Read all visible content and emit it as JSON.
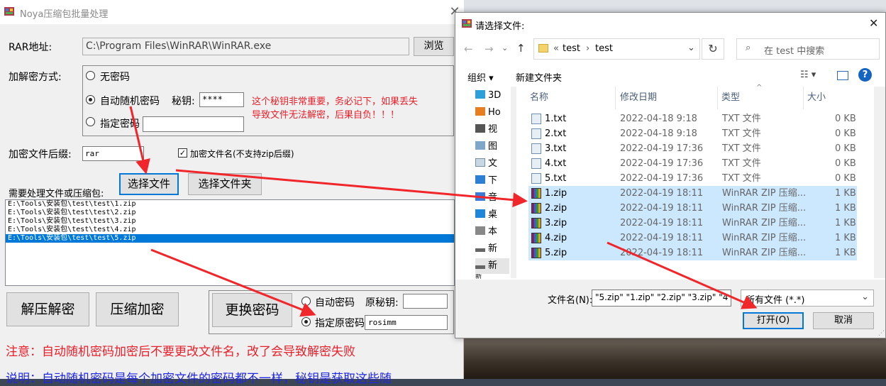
{
  "main": {
    "title": "Noya压缩包批量处理",
    "rar_label": "RAR地址:",
    "rar_path": "C:\\Program Files\\WinRAR\\WinRAR.exe",
    "browse": "浏览",
    "mode_label": "加解密方式:",
    "opt_none": "无密码",
    "opt_auto": "自动随机密码",
    "key_label": "秘钥:",
    "key_value": "****",
    "warning_line1": "这个秘钥非常重要，务必记下，如果丢失",
    "warning_line2": "导致文件无法解密，后果自负！！！",
    "opt_specify": "指定密码",
    "suffix_label": "加密文件后缀:",
    "suffix_value": "rar",
    "encrypt_name": "加密文件名(不支持zip后缀)",
    "select_file": "选择文件",
    "select_folder": "选择文件夹",
    "list_label": "需要处理文件或压缩包:",
    "files": [
      "E:\\Tools\\安装包\\test\\test\\1.zip",
      "E:\\Tools\\安装包\\test\\test\\2.zip",
      "E:\\Tools\\安装包\\test\\test\\3.zip",
      "E:\\Tools\\安装包\\test\\test\\4.zip",
      "E:\\Tools\\安装包\\test\\test\\5.zip"
    ],
    "decompress": "解压解密",
    "compress": "压缩加密",
    "change_pwd": "更换密码",
    "auto_pwd": "自动密码",
    "orig_key": "原秘钥:",
    "specify_orig": "指定原密码",
    "orig_pwd_value": "rosimm",
    "note": "注意：自动随机密码加密后不要更改文件名，改了会导致解密失败",
    "desc": "说明：自动随机密码是每个加密文件的密码都不一样，秘钥是获取这些随"
  },
  "dialog": {
    "title": "请选择文件:",
    "crumb_prefix": "«",
    "crumb1": "test",
    "crumb2": "test",
    "search_placeholder": "在 test 中搜索",
    "organize": "组织",
    "new_folder": "新建文件夹",
    "nav": [
      "3D",
      "Ho",
      "视",
      "图",
      "文",
      "下",
      "音",
      "桌",
      "本",
      "新",
      "新",
      "新"
    ],
    "col_name": "名称",
    "col_date": "修改日期",
    "col_type": "类型",
    "col_size": "大小",
    "rows": [
      {
        "name": "1.txt",
        "date": "2022-04-18 9:18",
        "type": "TXT 文件",
        "size": "0 KB"
      },
      {
        "name": "2.txt",
        "date": "2022-04-18 9:18",
        "type": "TXT 文件",
        "size": "0 KB"
      },
      {
        "name": "3.txt",
        "date": "2022-04-19 17:36",
        "type": "TXT 文件",
        "size": "0 KB"
      },
      {
        "name": "4.txt",
        "date": "2022-04-19 17:36",
        "type": "TXT 文件",
        "size": "0 KB"
      },
      {
        "name": "5.txt",
        "date": "2022-04-19 17:36",
        "type": "TXT 文件",
        "size": "0 KB"
      },
      {
        "name": "1.zip",
        "date": "2022-04-19 18:11",
        "type": "WinRAR ZIP 压缩...",
        "size": "1 KB"
      },
      {
        "name": "2.zip",
        "date": "2022-04-19 18:11",
        "type": "WinRAR ZIP 压缩...",
        "size": "1 KB"
      },
      {
        "name": "3.zip",
        "date": "2022-04-19 18:11",
        "type": "WinRAR ZIP 压缩...",
        "size": "1 KB"
      },
      {
        "name": "4.zip",
        "date": "2022-04-19 18:11",
        "type": "WinRAR ZIP 压缩...",
        "size": "1 KB"
      },
      {
        "name": "5.zip",
        "date": "2022-04-19 18:11",
        "type": "WinRAR ZIP 压缩...",
        "size": "1 KB"
      }
    ],
    "filename_label": "文件名(N):",
    "filename_value": "\"5.zip\" \"1.zip\" \"2.zip\" \"3.zip\" \"4",
    "filetype": "所有文件 (*.*)",
    "open": "打开(O)",
    "cancel": "取消"
  },
  "colors": {
    "accent": "#0078d7",
    "warning": "#e8202a",
    "note_blue": "#1f27e0",
    "arrow": "#f0262a",
    "selection": "#cce8ff"
  }
}
